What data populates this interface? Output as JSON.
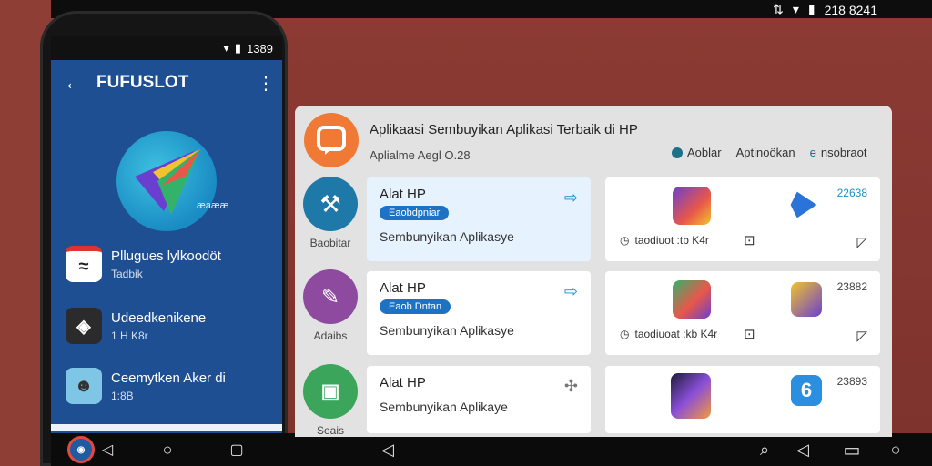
{
  "desktop": {
    "status_time": "218 8241",
    "status_icons": [
      "sync-icon",
      "wifi-icon",
      "battery-icon"
    ]
  },
  "phone": {
    "status_time": "1389",
    "app_title": "FUFUSLOT",
    "logo_caption": "æaææ",
    "list": [
      {
        "title": "Pllugues lylkoodöt",
        "subtitle": "Tadbik"
      },
      {
        "title": "Udeedkenikene",
        "subtitle": "1 H K8r"
      },
      {
        "title": "Ceemytken Aker di",
        "subtitle": "1:8B"
      }
    ]
  },
  "panel": {
    "title": "Aplikaasi Sembuyikan Aplikasi Terbaik di HP",
    "subtitle": "Aplialme Aegl O.28",
    "tabs": [
      "Aoblar",
      "Aptinoökan",
      "nsobraot"
    ],
    "categories": [
      "Baobitar",
      "Adaibs",
      "Seais"
    ],
    "rows": [
      {
        "name": "Alat HP",
        "badge": "Eaobdpniar",
        "desc": "Sembunyikan Aplikasye",
        "num": "22638",
        "meta": "taodiuot :tb K4r"
      },
      {
        "name": "Alat HP",
        "badge": "Eaob Dntan",
        "desc": "Sembunyikan Aplikasye",
        "num": "23882",
        "meta": "taodiuoat :kb K4r"
      },
      {
        "name": "Alat HP",
        "badge": "",
        "desc": "Sembunyikan Aplikaye",
        "num": "23893",
        "meta": ""
      }
    ]
  },
  "colors": {
    "wall": "#8f3e36",
    "phone_screen": "#1e4f92",
    "panel": "#e2e2e2",
    "accent_blue": "#1e72c4",
    "accent_orange": "#f07a35"
  }
}
